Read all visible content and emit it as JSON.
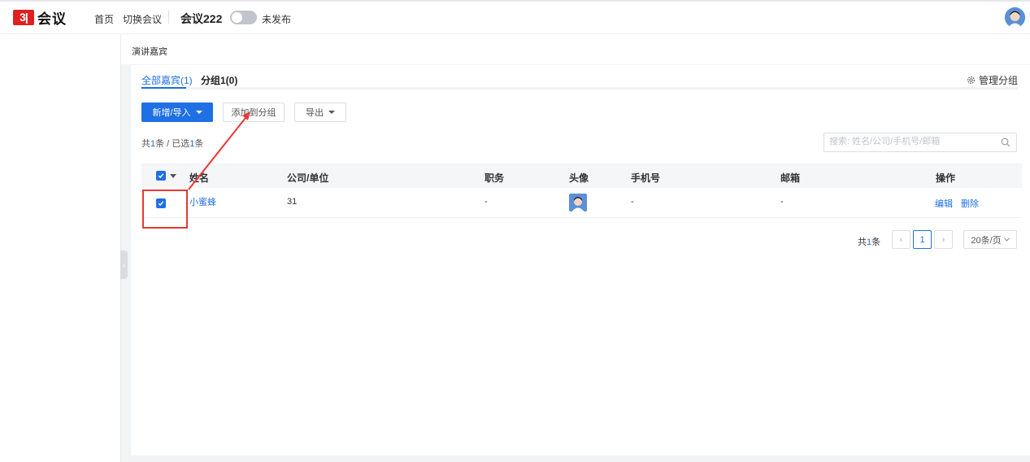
{
  "header": {
    "logo_mark": "3|",
    "logo_text": "会议",
    "nav": [
      "首页",
      "切换会议"
    ],
    "meeting_name": "会议222",
    "publish_status": "未发布"
  },
  "breadcrumb": "演讲嘉宾",
  "tabs": [
    {
      "label": "全部嘉宾(1)",
      "active": true
    },
    {
      "label": "分组1(0)",
      "active": false
    }
  ],
  "manage_group": "管理分组",
  "toolbar": {
    "add_import": "新增/导入",
    "add_to_group": "添加到分组",
    "export": "导出"
  },
  "count": {
    "prefix": "共",
    "total": "1",
    "mid": "条 / 已选",
    "selected": "1",
    "suffix": "条"
  },
  "search": {
    "placeholder": "搜索: 姓名/公司/手机号/邮箱"
  },
  "table": {
    "columns": [
      "姓名",
      "公司/单位",
      "职务",
      "头像",
      "手机号",
      "邮箱",
      "操作"
    ],
    "rows": [
      {
        "name": "小蜜蜂",
        "company": "31",
        "title": "-",
        "phone": "-",
        "email": "-",
        "edit": "编辑",
        "delete": "删除"
      }
    ]
  },
  "pagination": {
    "total_prefix": "共",
    "total": "1",
    "total_suffix": "条",
    "prev": "‹",
    "current": "1",
    "next": "›",
    "page_size": "20条/页"
  },
  "colors": {
    "primary": "#1f6fe5",
    "annotation": "#e53935"
  }
}
